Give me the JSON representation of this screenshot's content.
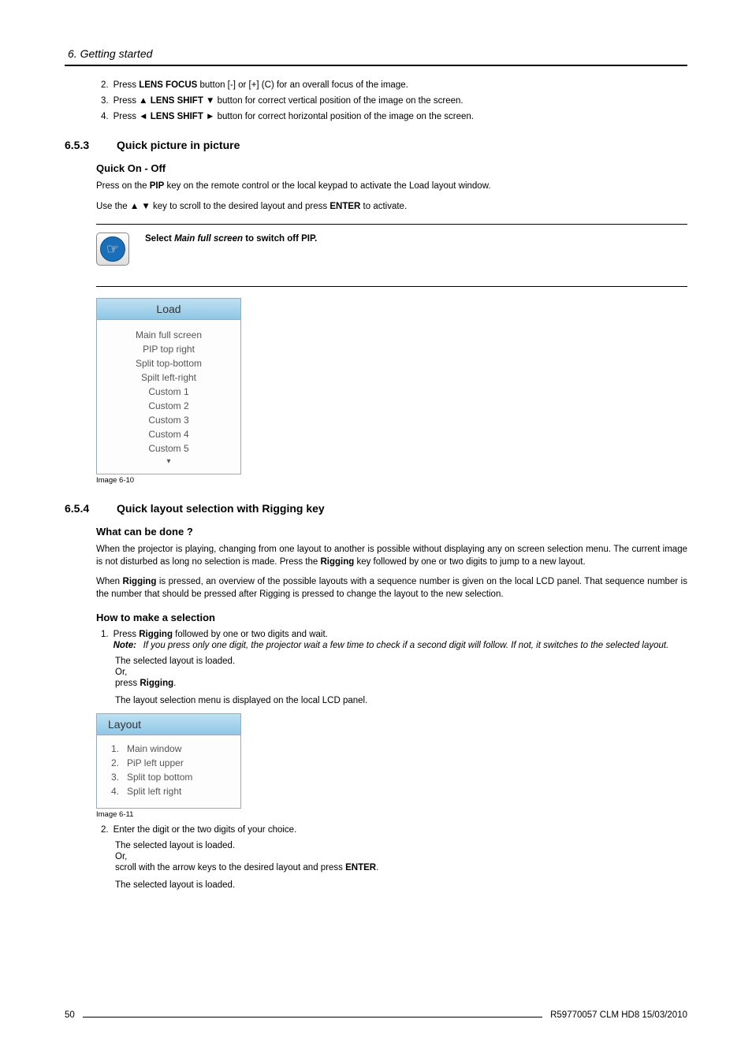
{
  "chapter": "6.  Getting started",
  "steps_top": [
    {
      "n": "2.",
      "pre": "Press ",
      "b": "LENS FOCUS",
      "post": " button [-] or [+] (C) for an overall focus of the image."
    },
    {
      "n": "3.",
      "pre": "Press ▲ ",
      "b": "LENS SHIFT",
      "post": " ▼ button for correct vertical position of the image on the screen."
    },
    {
      "n": "4.",
      "pre": "Press ◄ ",
      "b": "LENS SHIFT",
      "post": " ► button for correct horizontal position of the image on the screen."
    }
  ],
  "s653": {
    "num": "6.5.3",
    "title": "Quick picture in picture"
  },
  "quick_on_off": "Quick On - Off",
  "pip_p1": {
    "pre": "Press on the ",
    "b": "PIP",
    "post": " key on the remote control or the local keypad to activate the Load layout window."
  },
  "pip_p2": {
    "pre": "Use the ▲ ▼ key to scroll to the desired layout and press ",
    "b": "ENTER",
    "post": " to activate."
  },
  "note": {
    "pre": "Select ",
    "mfs": "Main full screen",
    "post": " to switch off PIP."
  },
  "load_menu": {
    "title": "Load",
    "items": [
      "Main full screen",
      "PIP top right",
      "Split top-bottom",
      "Spilt left-right",
      "Custom 1",
      "Custom 2",
      "Custom 3",
      "Custom 4",
      "Custom 5"
    ]
  },
  "cap610": "Image 6-10",
  "s654": {
    "num": "6.5.4",
    "title": "Quick layout selection with Rigging key"
  },
  "whatcanbedone": "What can be done ?",
  "para_wc1": {
    "a": "When the projector is playing, changing from one layout to another is possible without displaying any on screen selection menu. The current image is not disturbed as long no selection is made. Press the ",
    "b": "Rigging",
    "c": " key followed by one or two digits to jump to a new layout."
  },
  "para_wc2": {
    "a": "When ",
    "b": "Rigging",
    "c": " is pressed, an overview of the possible layouts with a sequence number is given on the local LCD panel. That sequence number is the number that should be pressed after Rigging is pressed to change the layout to the new selection."
  },
  "howto": "How to make a selection",
  "step1": {
    "n": "1.",
    "pre": "Press ",
    "b": "Rigging",
    "post": " followed by one or two digits and wait."
  },
  "step1_note": {
    "label": "Note:",
    "text": "If you press only one digit, the projector wait a few time to check if a second digit will follow. If not, it switches to the selected layout."
  },
  "step1_a": "The selected layout is loaded.",
  "step1_b": "Or,",
  "step1_c": {
    "pre": "press ",
    "b": "Rigging",
    "post": "."
  },
  "step1_d": "The layout selection menu is displayed on the local LCD panel.",
  "layout_menu": {
    "title": "Layout",
    "items": [
      {
        "n": "1.",
        "t": "Main window"
      },
      {
        "n": "2.",
        "t": "PiP left upper"
      },
      {
        "n": "3.",
        "t": "Split top bottom"
      },
      {
        "n": "4.",
        "t": "Split left right"
      }
    ]
  },
  "cap611": "Image 6-11",
  "step2": {
    "n": "2.",
    "text": "Enter the digit or the two digits of your choice."
  },
  "step2_a": "The selected layout is loaded.",
  "step2_b": "Or,",
  "step2_c": {
    "pre": "scroll with the arrow keys to the desired layout and press ",
    "b": "ENTER",
    "post": "."
  },
  "step2_d": "The selected layout is loaded.",
  "footer": {
    "page": "50",
    "doc": "R59770057 CLM HD8 15/03/2010"
  }
}
